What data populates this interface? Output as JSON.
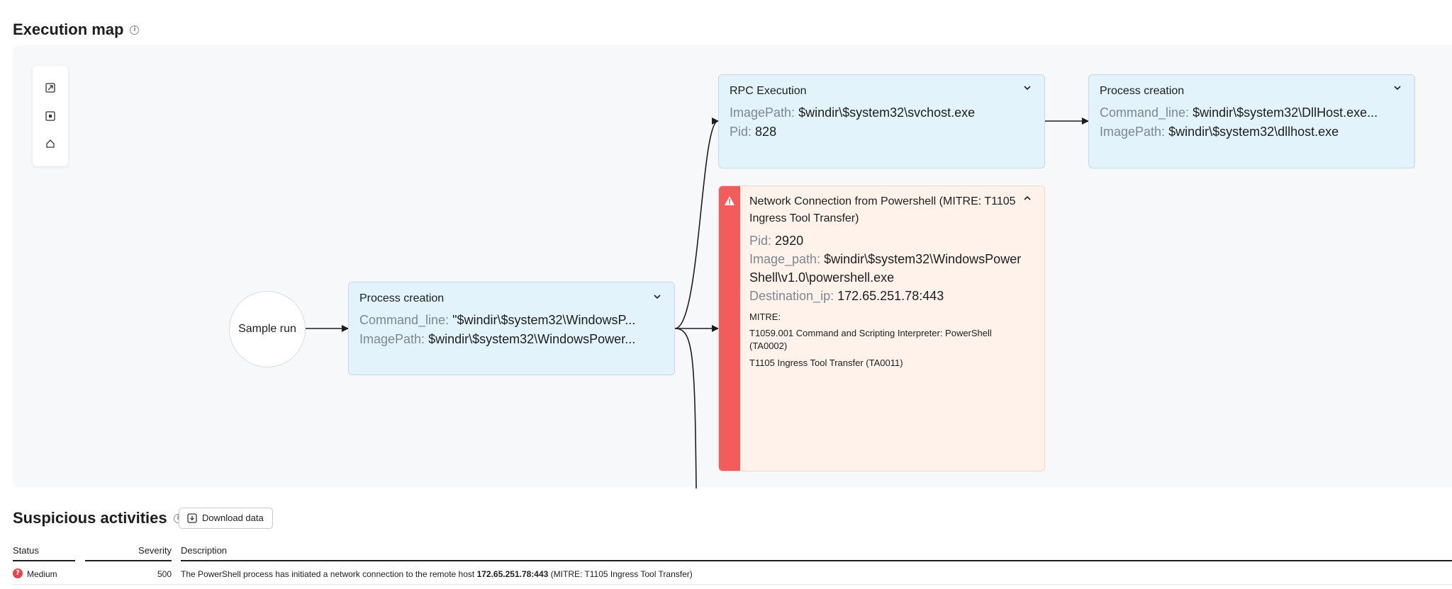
{
  "execution_map": {
    "title": "Execution map",
    "info_icon": "info-icon",
    "toolbar": {
      "buttons": [
        {
          "icon": "export-icon"
        },
        {
          "icon": "fit-view-icon"
        },
        {
          "icon": "home-icon"
        }
      ]
    },
    "start_node": {
      "label": "Sample run"
    },
    "process_node": {
      "title": "Process creation",
      "fields": [
        {
          "key": "Command_line:",
          "value": "\"$windir\\$system32\\WindowsP..."
        },
        {
          "key": "ImagePath:",
          "value": "$windir\\$system32\\WindowsPower..."
        }
      ]
    },
    "rpc_node": {
      "title": "RPC Execution",
      "fields": [
        {
          "key": "ImagePath:",
          "value": "$windir\\$system32\\svchost.exe"
        },
        {
          "key": "Pid:",
          "value": "828"
        }
      ]
    },
    "child_process_node": {
      "title": "Process creation",
      "fields": [
        {
          "key": "Command_line:",
          "value": "$windir\\$system32\\DllHost.exe..."
        },
        {
          "key": "ImagePath:",
          "value": "$windir\\$system32\\dllhost.exe"
        }
      ]
    },
    "alert_node": {
      "title": "Network Connection from Powershell (MITRE: T1105 Ingress Tool Transfer)",
      "fields": [
        {
          "key": "Pid:",
          "value": "2920"
        },
        {
          "key": "Image_path:",
          "value": "$windir\\$system32\\WindowsPowerShell\\v1.0\\powershell.exe"
        },
        {
          "key": "Destination_ip:",
          "value": "172.65.251.78:443"
        }
      ],
      "mitre_label": "MITRE:",
      "mitre_items": [
        "T1059.001 Command and Scripting Interpreter: PowerShell (TA0002)",
        "T1105 Ingress Tool Transfer (TA0011)"
      ],
      "colors": {
        "bar": "#f25c5c",
        "background": "#fff2ea"
      }
    },
    "colors": {
      "node_bg": "#e2f3fb",
      "map_bg": "#f6f8fa"
    }
  },
  "suspicious_activities": {
    "title": "Suspicious activities",
    "download_label": "Download data",
    "columns": {
      "status": "Status",
      "severity": "Severity",
      "description": "Description"
    },
    "rows": [
      {
        "status": "Medium",
        "severity": "500",
        "description_prefix": "The PowerShell process has initiated a network connection to the remote host ",
        "description_host": "172.65.251.78:443",
        "description_suffix": " (MITRE: T1105 Ingress Tool Transfer)"
      }
    ]
  }
}
